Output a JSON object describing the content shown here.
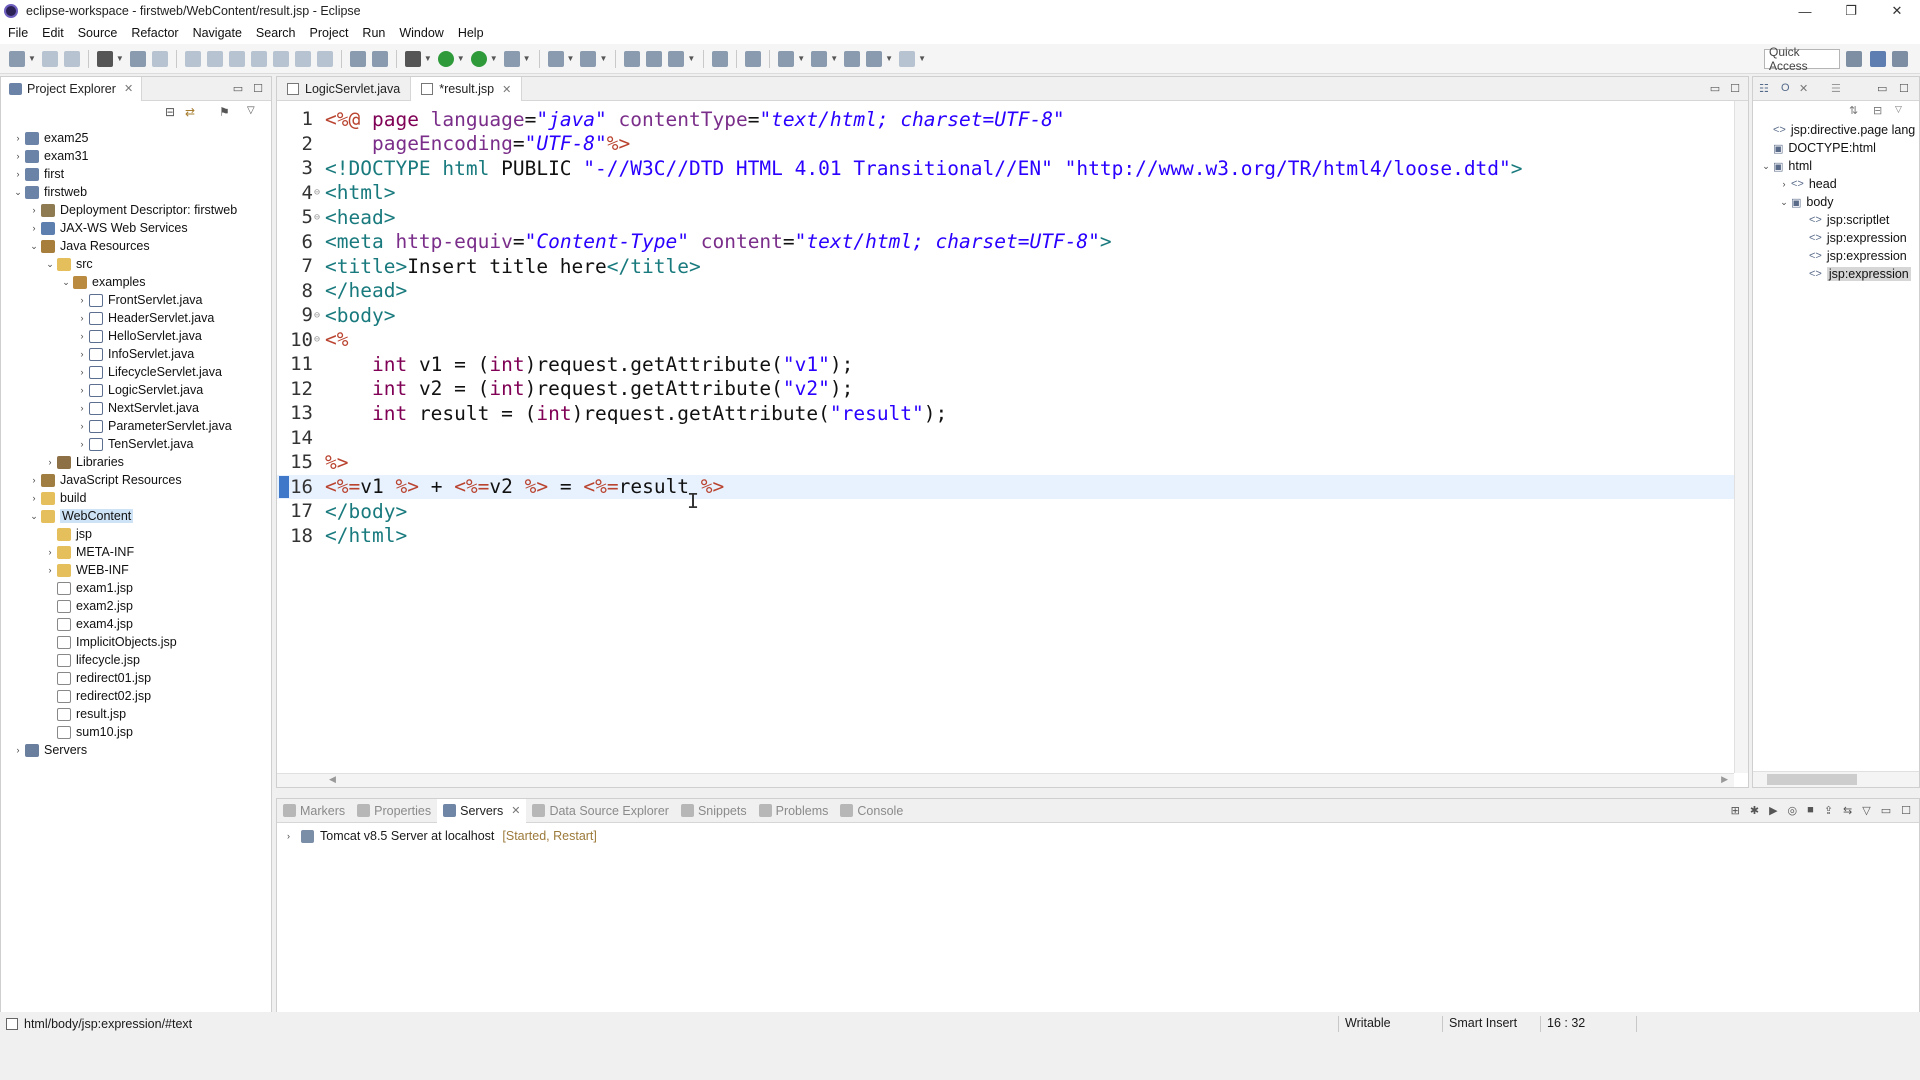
{
  "window": {
    "title": "eclipse-workspace - firstweb/WebContent/result.jsp - Eclipse",
    "controls": [
      "—",
      "❐",
      "✕"
    ]
  },
  "menu": [
    "File",
    "Edit",
    "Source",
    "Refactor",
    "Navigate",
    "Search",
    "Project",
    "Run",
    "Window",
    "Help"
  ],
  "toolbar": {
    "quick_access": "Quick Access"
  },
  "project_explorer": {
    "title": "Project Explorer",
    "rows": [
      {
        "indent": 0,
        "twisty": "›",
        "icon": "proj",
        "label": "exam25"
      },
      {
        "indent": 0,
        "twisty": "›",
        "icon": "proj",
        "label": "exam31"
      },
      {
        "indent": 0,
        "twisty": "›",
        "icon": "proj",
        "label": "first"
      },
      {
        "indent": 0,
        "twisty": "⌄",
        "icon": "proj",
        "label": "firstweb"
      },
      {
        "indent": 1,
        "twisty": "›",
        "icon": "dd",
        "label": "Deployment Descriptor: firstweb"
      },
      {
        "indent": 1,
        "twisty": "›",
        "icon": "ws",
        "label": "JAX-WS Web Services"
      },
      {
        "indent": 1,
        "twisty": "⌄",
        "icon": "jr",
        "label": "Java Resources"
      },
      {
        "indent": 2,
        "twisty": "⌄",
        "icon": "fold",
        "label": "src"
      },
      {
        "indent": 3,
        "twisty": "⌄",
        "icon": "pkg",
        "label": "examples"
      },
      {
        "indent": 4,
        "twisty": "›",
        "icon": "java",
        "label": "FrontServlet.java"
      },
      {
        "indent": 4,
        "twisty": "›",
        "icon": "java",
        "label": "HeaderServlet.java"
      },
      {
        "indent": 4,
        "twisty": "›",
        "icon": "java",
        "label": "HelloServlet.java"
      },
      {
        "indent": 4,
        "twisty": "›",
        "icon": "java",
        "label": "InfoServlet.java"
      },
      {
        "indent": 4,
        "twisty": "›",
        "icon": "java",
        "label": "LifecycleServlet.java"
      },
      {
        "indent": 4,
        "twisty": "›",
        "icon": "java",
        "label": "LogicServlet.java"
      },
      {
        "indent": 4,
        "twisty": "›",
        "icon": "java",
        "label": "NextServlet.java"
      },
      {
        "indent": 4,
        "twisty": "›",
        "icon": "java",
        "label": "ParameterServlet.java"
      },
      {
        "indent": 4,
        "twisty": "›",
        "icon": "java",
        "label": "TenServlet.java"
      },
      {
        "indent": 2,
        "twisty": "›",
        "icon": "lib",
        "label": "Libraries"
      },
      {
        "indent": 1,
        "twisty": "›",
        "icon": "js",
        "label": "JavaScript Resources"
      },
      {
        "indent": 1,
        "twisty": "›",
        "icon": "fold",
        "label": "build"
      },
      {
        "indent": 1,
        "twisty": "⌄",
        "icon": "fold",
        "label": "WebContent",
        "selected": true
      },
      {
        "indent": 2,
        "twisty": "",
        "icon": "fold",
        "label": "jsp"
      },
      {
        "indent": 2,
        "twisty": "›",
        "icon": "fold",
        "label": "META-INF"
      },
      {
        "indent": 2,
        "twisty": "›",
        "icon": "fold",
        "label": "WEB-INF"
      },
      {
        "indent": 2,
        "twisty": "",
        "icon": "jsf",
        "label": "exam1.jsp"
      },
      {
        "indent": 2,
        "twisty": "",
        "icon": "jsf",
        "label": "exam2.jsp"
      },
      {
        "indent": 2,
        "twisty": "",
        "icon": "jsf",
        "label": "exam4.jsp"
      },
      {
        "indent": 2,
        "twisty": "",
        "icon": "jsf",
        "label": "ImplicitObjects.jsp"
      },
      {
        "indent": 2,
        "twisty": "",
        "icon": "jsf",
        "label": "lifecycle.jsp"
      },
      {
        "indent": 2,
        "twisty": "",
        "icon": "jsf",
        "label": "redirect01.jsp"
      },
      {
        "indent": 2,
        "twisty": "",
        "icon": "jsf",
        "label": "redirect02.jsp"
      },
      {
        "indent": 2,
        "twisty": "",
        "icon": "jsf",
        "label": "result.jsp"
      },
      {
        "indent": 2,
        "twisty": "",
        "icon": "jsf",
        "label": "sum10.jsp"
      },
      {
        "indent": 0,
        "twisty": "›",
        "icon": "srv",
        "label": "Servers"
      }
    ]
  },
  "editor": {
    "tabs": [
      {
        "label": "LogicServlet.java",
        "active": false
      },
      {
        "label": "*result.jsp",
        "active": true
      }
    ],
    "current_line": 16,
    "lines": [
      {
        "n": "1",
        "fold": "",
        "segs": [
          [
            "t-jsp",
            "<%@ "
          ],
          [
            "t-kw",
            "page "
          ],
          [
            "t-attr",
            "language"
          ],
          [
            "t-plain",
            "="
          ],
          [
            "t-str",
            "\"java\""
          ],
          [
            "t-plain",
            " "
          ],
          [
            "t-attr",
            "contentType"
          ],
          [
            "t-plain",
            "="
          ],
          [
            "t-str",
            "\"text/html; charset=UTF-8\""
          ]
        ]
      },
      {
        "n": "2",
        "fold": "",
        "segs": [
          [
            "t-plain",
            "    "
          ],
          [
            "t-attr",
            "pageEncoding"
          ],
          [
            "t-plain",
            "="
          ],
          [
            "t-str",
            "\"UTF-8\""
          ],
          [
            "t-jsp",
            "%>"
          ]
        ]
      },
      {
        "n": "3",
        "fold": "",
        "segs": [
          [
            "t-doc",
            "<!DOCTYPE "
          ],
          [
            "t-tag",
            "html "
          ],
          [
            "t-plain",
            "PUBLIC "
          ],
          [
            "t-str2",
            "\"-//W3C//DTD HTML 4.01 Transitional//EN\""
          ],
          [
            "t-plain",
            " "
          ],
          [
            "t-str2",
            "\"http://www.w3.org/TR/html4/loose.dtd\""
          ],
          [
            "t-doc",
            ">"
          ]
        ]
      },
      {
        "n": "4",
        "fold": "⊖",
        "segs": [
          [
            "t-tag",
            "<html>"
          ]
        ]
      },
      {
        "n": "5",
        "fold": "⊖",
        "segs": [
          [
            "t-tag",
            "<head>"
          ]
        ]
      },
      {
        "n": "6",
        "fold": "",
        "segs": [
          [
            "t-tag",
            "<meta "
          ],
          [
            "t-attr",
            "http-equiv"
          ],
          [
            "t-plain",
            "="
          ],
          [
            "t-str",
            "\"Content-Type\""
          ],
          [
            "t-plain",
            " "
          ],
          [
            "t-attr",
            "content"
          ],
          [
            "t-plain",
            "="
          ],
          [
            "t-str",
            "\"text/html; charset=UTF-8\""
          ],
          [
            "t-tag",
            ">"
          ]
        ]
      },
      {
        "n": "7",
        "fold": "",
        "segs": [
          [
            "t-tag",
            "<title>"
          ],
          [
            "t-plain",
            "Insert title here"
          ],
          [
            "t-tag",
            "</title>"
          ]
        ]
      },
      {
        "n": "8",
        "fold": "",
        "segs": [
          [
            "t-tag",
            "</head>"
          ]
        ]
      },
      {
        "n": "9",
        "fold": "⊖",
        "segs": [
          [
            "t-tag",
            "<body>"
          ]
        ]
      },
      {
        "n": "10",
        "fold": "⊖",
        "segs": [
          [
            "t-jsp",
            "<%"
          ]
        ]
      },
      {
        "n": "11",
        "fold": "",
        "segs": [
          [
            "t-plain",
            "    "
          ],
          [
            "t-kw",
            "int"
          ],
          [
            "t-plain",
            " v1 = ("
          ],
          [
            "t-kw",
            "int"
          ],
          [
            "t-plain",
            ")request.getAttribute("
          ],
          [
            "t-str2",
            "\"v1\""
          ],
          [
            "t-plain",
            ");"
          ]
        ]
      },
      {
        "n": "12",
        "fold": "",
        "segs": [
          [
            "t-plain",
            "    "
          ],
          [
            "t-kw",
            "int"
          ],
          [
            "t-plain",
            " v2 = ("
          ],
          [
            "t-kw",
            "int"
          ],
          [
            "t-plain",
            ")request.getAttribute("
          ],
          [
            "t-str2",
            "\"v2\""
          ],
          [
            "t-plain",
            ");"
          ]
        ]
      },
      {
        "n": "13",
        "fold": "",
        "segs": [
          [
            "t-plain",
            "    "
          ],
          [
            "t-kw",
            "int"
          ],
          [
            "t-plain",
            " result = ("
          ],
          [
            "t-kw",
            "int"
          ],
          [
            "t-plain",
            ")request.getAttribute("
          ],
          [
            "t-str2",
            "\"result\""
          ],
          [
            "t-plain",
            ");"
          ]
        ]
      },
      {
        "n": "14",
        "fold": "",
        "segs": []
      },
      {
        "n": "15",
        "fold": "",
        "segs": [
          [
            "t-jsp",
            "%>"
          ]
        ]
      },
      {
        "n": "16",
        "fold": "",
        "segs": [
          [
            "t-jsp",
            "<%="
          ],
          [
            "t-plain",
            "v1 "
          ],
          [
            "t-jsp",
            "%>"
          ],
          [
            "t-plain",
            " + "
          ],
          [
            "t-jsp",
            "<%="
          ],
          [
            "t-plain",
            "v2 "
          ],
          [
            "t-jsp",
            "%>"
          ],
          [
            "t-plain",
            " = "
          ],
          [
            "t-jsp",
            "<%="
          ],
          [
            "t-plain",
            "result "
          ],
          [
            "t-jsp",
            "%>"
          ]
        ]
      },
      {
        "n": "17",
        "fold": "",
        "segs": [
          [
            "t-tag",
            "</body>"
          ]
        ]
      },
      {
        "n": "18",
        "fold": "",
        "segs": [
          [
            "t-tag",
            "</html>"
          ]
        ]
      }
    ]
  },
  "outline": {
    "rows": [
      {
        "indent": 0,
        "twisty": "",
        "tag": "<>",
        "label": "jsp:directive.page lang"
      },
      {
        "indent": 0,
        "twisty": "",
        "tag": "▣",
        "label": "DOCTYPE:html"
      },
      {
        "indent": 0,
        "twisty": "⌄",
        "tag": "▣",
        "label": "html"
      },
      {
        "indent": 1,
        "twisty": "›",
        "tag": "<>",
        "label": "head"
      },
      {
        "indent": 1,
        "twisty": "⌄",
        "tag": "▣",
        "label": "body"
      },
      {
        "indent": 2,
        "twisty": "",
        "tag": "<>",
        "label": "jsp:scriptlet"
      },
      {
        "indent": 2,
        "twisty": "",
        "tag": "<>",
        "label": "jsp:expression"
      },
      {
        "indent": 2,
        "twisty": "",
        "tag": "<>",
        "label": "jsp:expression"
      },
      {
        "indent": 2,
        "twisty": "",
        "tag": "<>",
        "label": "jsp:expression",
        "selected": true
      }
    ]
  },
  "bottom": {
    "tabs": [
      {
        "label": "Markers",
        "active": false
      },
      {
        "label": "Properties",
        "active": false
      },
      {
        "label": "Servers",
        "active": true
      },
      {
        "label": "Data Source Explorer",
        "active": false
      },
      {
        "label": "Snippets",
        "active": false
      },
      {
        "label": "Problems",
        "active": false
      },
      {
        "label": "Console",
        "active": false
      }
    ],
    "server": {
      "name": "Tomcat v8.5 Server at localhost",
      "status": "[Started, Restart]"
    }
  },
  "status": {
    "path": "html/body/jsp:expression/#text",
    "writable": "Writable",
    "insert_mode": "Smart Insert",
    "position": "16 : 32"
  }
}
